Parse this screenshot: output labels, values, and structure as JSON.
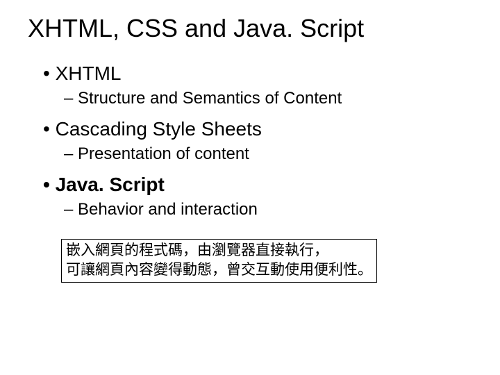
{
  "title": "XHTML, CSS and Java. Script",
  "items": [
    {
      "label": "XHTML",
      "bold": false,
      "sub": "Structure and Semantics of Content"
    },
    {
      "label": "Cascading Style Sheets",
      "bold": false,
      "sub": "Presentation of content"
    },
    {
      "label": "Java. Script",
      "bold": true,
      "sub": "Behavior and interaction"
    }
  ],
  "note": {
    "line1": "嵌入網頁的程式碼，由瀏覽器直接執行，",
    "line2": "可讓網頁內容變得動態，曾交互動使用便利性。"
  }
}
